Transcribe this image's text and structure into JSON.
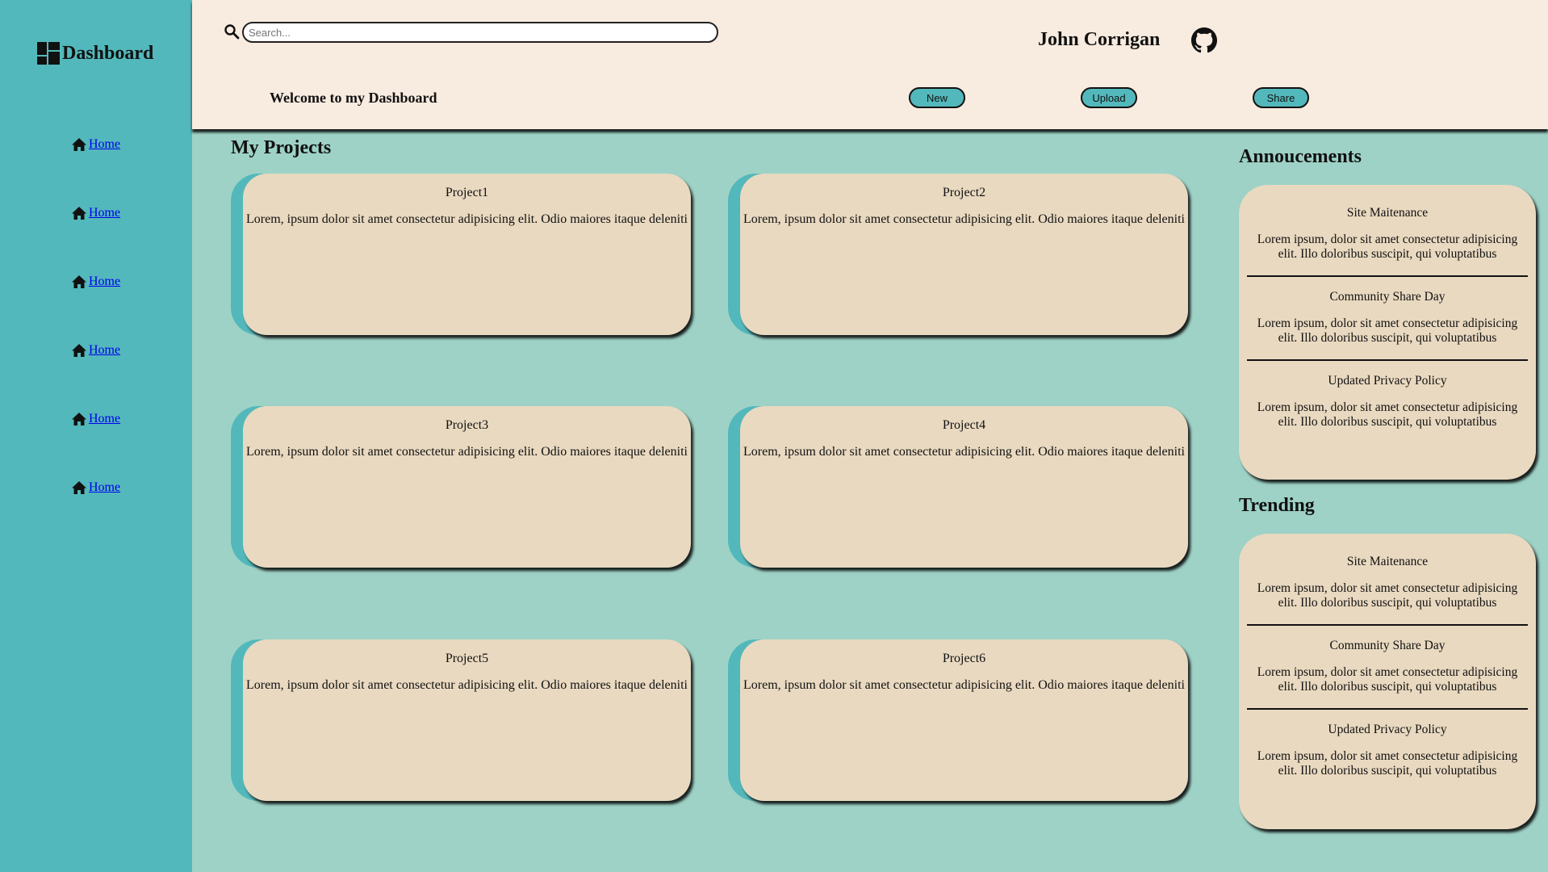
{
  "sidebar": {
    "brand": "Dashboard",
    "items": [
      {
        "label": "Home"
      },
      {
        "label": "Home"
      },
      {
        "label": "Home"
      },
      {
        "label": "Home"
      },
      {
        "label": "Home"
      },
      {
        "label": "Home"
      }
    ]
  },
  "header": {
    "search_placeholder": "Search...",
    "user_name": "John Corrigan",
    "welcome": "Welcome to my Dashboard",
    "buttons": {
      "new": "New",
      "upload": "Upload",
      "share": "Share"
    }
  },
  "projects": {
    "title": "My Projects",
    "items": [
      {
        "title": "Project1",
        "text": "Lorem, ipsum dolor sit amet consectetur adipisicing elit. Odio maiores itaque deleniti"
      },
      {
        "title": "Project2",
        "text": "Lorem, ipsum dolor sit amet consectetur adipisicing elit. Odio maiores itaque deleniti"
      },
      {
        "title": "Project3",
        "text": "Lorem, ipsum dolor sit amet consectetur adipisicing elit. Odio maiores itaque deleniti"
      },
      {
        "title": "Project4",
        "text": "Lorem, ipsum dolor sit amet consectetur adipisicing elit. Odio maiores itaque deleniti"
      },
      {
        "title": "Project5",
        "text": "Lorem, ipsum dolor sit amet consectetur adipisicing elit. Odio maiores itaque deleniti"
      },
      {
        "title": "Project6",
        "text": "Lorem, ipsum dolor sit amet consectetur adipisicing elit. Odio maiores itaque deleniti"
      }
    ]
  },
  "announcements": {
    "title": "Annoucements",
    "items": [
      {
        "title": "Site Maitenance",
        "text": "Lorem ipsum, dolor sit amet consectetur adipisicing elit. Illo doloribus suscipit, qui voluptatibus"
      },
      {
        "title": "Community Share Day",
        "text": "Lorem ipsum, dolor sit amet consectetur adipisicing elit. Illo doloribus suscipit, qui voluptatibus"
      },
      {
        "title": "Updated Privacy Policy",
        "text": "Lorem ipsum, dolor sit amet consectetur adipisicing elit. Illo doloribus suscipit, qui voluptatibus"
      }
    ]
  },
  "trending": {
    "title": "Trending",
    "items": [
      {
        "title": "Site Maitenance",
        "text": "Lorem ipsum, dolor sit amet consectetur adipisicing elit. Illo doloribus suscipit, qui voluptatibus"
      },
      {
        "title": "Community Share Day",
        "text": "Lorem ipsum, dolor sit amet consectetur adipisicing elit. Illo doloribus suscipit, qui voluptatibus"
      },
      {
        "title": "Updated Privacy Policy",
        "text": "Lorem ipsum, dolor sit amet consectetur adipisicing elit. Illo doloribus suscipit, qui voluptatibus"
      }
    ]
  },
  "colors": {
    "sidebar": "#53b8bb",
    "header": "#f8ebdf",
    "background": "#9ed2c6",
    "card": "#e9d9c0",
    "accent": "#53b8bb"
  },
  "icons": {
    "brand": "dashboard-icon",
    "nav": "home-icon",
    "search": "search-icon",
    "profile": "github-icon"
  }
}
